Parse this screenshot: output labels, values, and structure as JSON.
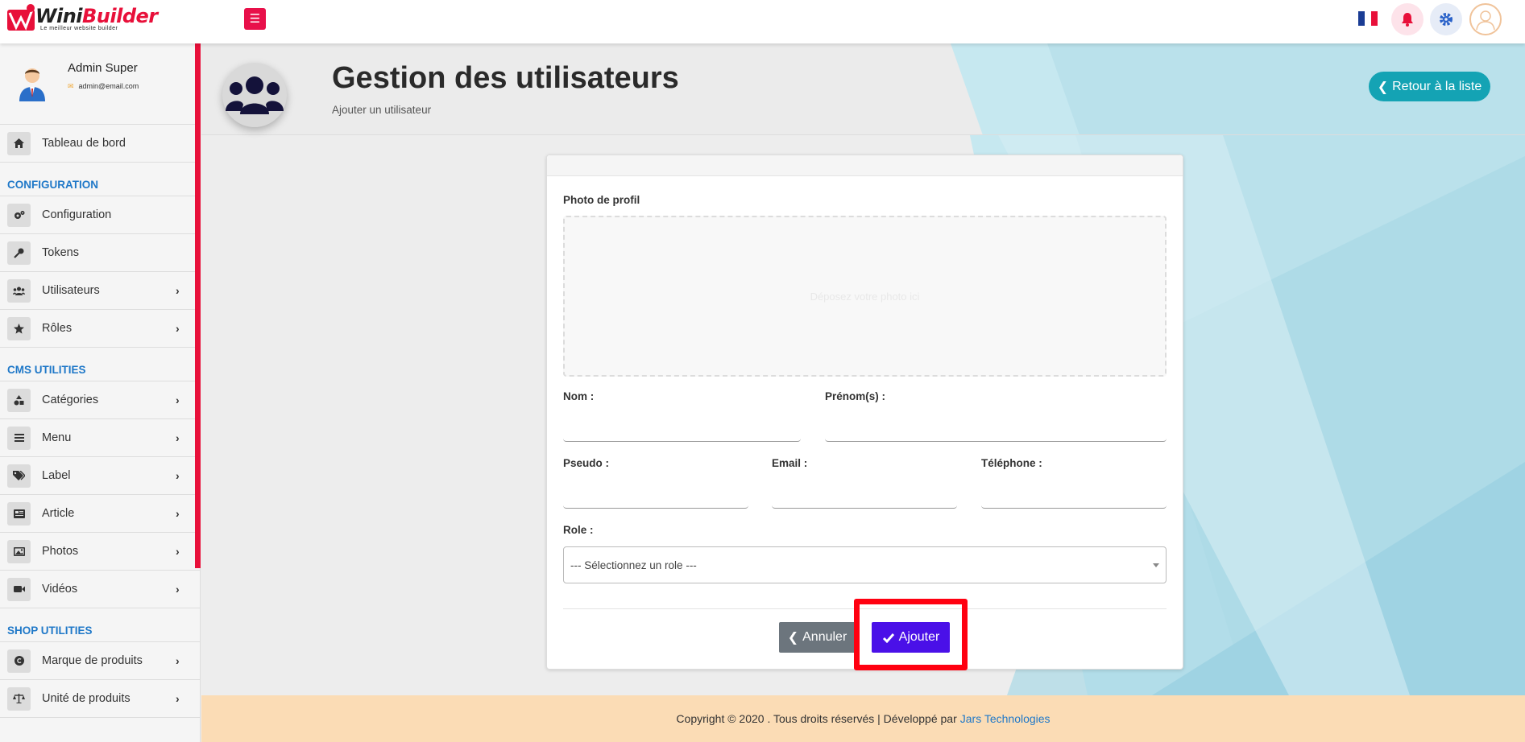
{
  "brand": {
    "name_part1": "Wini",
    "name_part2": "Builder",
    "tagline": "Le meilleur website builder"
  },
  "topbar": {
    "menu_icon": "bars-icon",
    "language": "FR",
    "notification_icon": "bell-icon",
    "settings_icon": "gear-icon",
    "avatar_icon": "user-avatar-icon"
  },
  "user": {
    "name": "Admin Super",
    "email": "admin@email.com"
  },
  "sidebar": {
    "top_items": [
      {
        "label": "Tableau de bord",
        "icon": "home-icon"
      }
    ],
    "sections": [
      {
        "title": "CONFIGURATION",
        "items": [
          {
            "label": "Configuration",
            "icon": "cogs-icon",
            "expandable": false
          },
          {
            "label": "Tokens",
            "icon": "key-icon",
            "expandable": false
          },
          {
            "label": "Utilisateurs",
            "icon": "users-icon",
            "expandable": true
          },
          {
            "label": "Rôles",
            "icon": "star-icon",
            "expandable": true
          }
        ]
      },
      {
        "title": "CMS UTILITIES",
        "items": [
          {
            "label": "Catégories",
            "icon": "shapes-icon",
            "expandable": true
          },
          {
            "label": "Menu",
            "icon": "list-icon",
            "expandable": true
          },
          {
            "label": "Label",
            "icon": "tags-icon",
            "expandable": true
          },
          {
            "label": "Article",
            "icon": "newspaper-icon",
            "expandable": true
          },
          {
            "label": "Photos",
            "icon": "image-icon",
            "expandable": true
          },
          {
            "label": "Vidéos",
            "icon": "video-icon",
            "expandable": true
          }
        ]
      },
      {
        "title": "SHOP UTILITIES",
        "items": [
          {
            "label": "Marque de produits",
            "icon": "copyright-icon",
            "expandable": true
          },
          {
            "label": "Unité de produits",
            "icon": "balance-scale-icon",
            "expandable": true
          }
        ]
      }
    ]
  },
  "header": {
    "title": "Gestion des utilisateurs",
    "subtitle": "Ajouter un utilisateur",
    "back_label": "Retour à la liste",
    "icon": "users-icon"
  },
  "form": {
    "photo_label": "Photo de profil",
    "dropzone_text": "Déposez votre photo ici",
    "nom_label": "Nom :",
    "nom_value": "",
    "prenom_label": "Prénom(s) :",
    "prenom_value": "",
    "pseudo_label": "Pseudo :",
    "pseudo_value": "",
    "email_label": "Email :",
    "email_value": "",
    "telephone_label": "Téléphone :",
    "telephone_value": "",
    "role_label": "Role :",
    "role_selected": "--- Sélectionnez un role ---",
    "cancel_label": "Annuler",
    "submit_label": "Ajouter"
  },
  "footer": {
    "text": "Copyright © 2020 . Tous droits réservés | Développé par",
    "link": "Jars Technologies"
  },
  "colors": {
    "accent": "#e8103a",
    "teal": "#14a3b4",
    "submit": "#4a10e8",
    "cancel": "#6c757d",
    "section_title": "#1f78c8",
    "footer_bg": "#fbdcb5",
    "highlight": "#ff0010"
  }
}
